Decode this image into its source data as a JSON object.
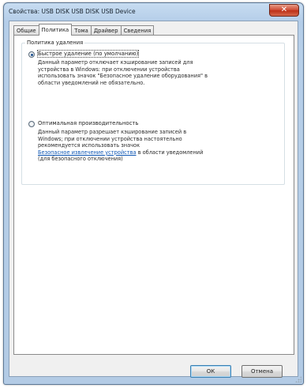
{
  "window": {
    "title": "Свойства: USB DISK USB DISK USB Device",
    "close_glyph": "✕"
  },
  "tabs": [
    {
      "label": "Общие",
      "active": false
    },
    {
      "label": "Политика",
      "active": true
    },
    {
      "label": "Тома",
      "active": false
    },
    {
      "label": "Драйвер",
      "active": false
    },
    {
      "label": "Сведения",
      "active": false
    }
  ],
  "policy": {
    "group_title": "Политика удаления",
    "quick_removal": {
      "label": "Быстрое удаление (по умолчанию)",
      "selected": true,
      "description": [
        "Данный параметр отключает кэширование записей для",
        "устройства в Windows: при отключении устройства",
        "использовать значок \"Безопасное удаление оборудования\" в",
        "области уведомлений не обязательно."
      ]
    },
    "better_performance": {
      "label": "Оптимальная производительность",
      "selected": false,
      "description_lines": [
        "Данный параметр разрешает кэширование записей в",
        "Windows; при отключении устройства настоятельно",
        "рекомендуется использовать значок"
      ],
      "link_text": "Безопасное извлечение устройства",
      "after_link": " в области уведомлений",
      "last_line": "(для безопасного отключения)"
    }
  },
  "buttons": {
    "ok": "ОК",
    "cancel": "Отмена"
  }
}
